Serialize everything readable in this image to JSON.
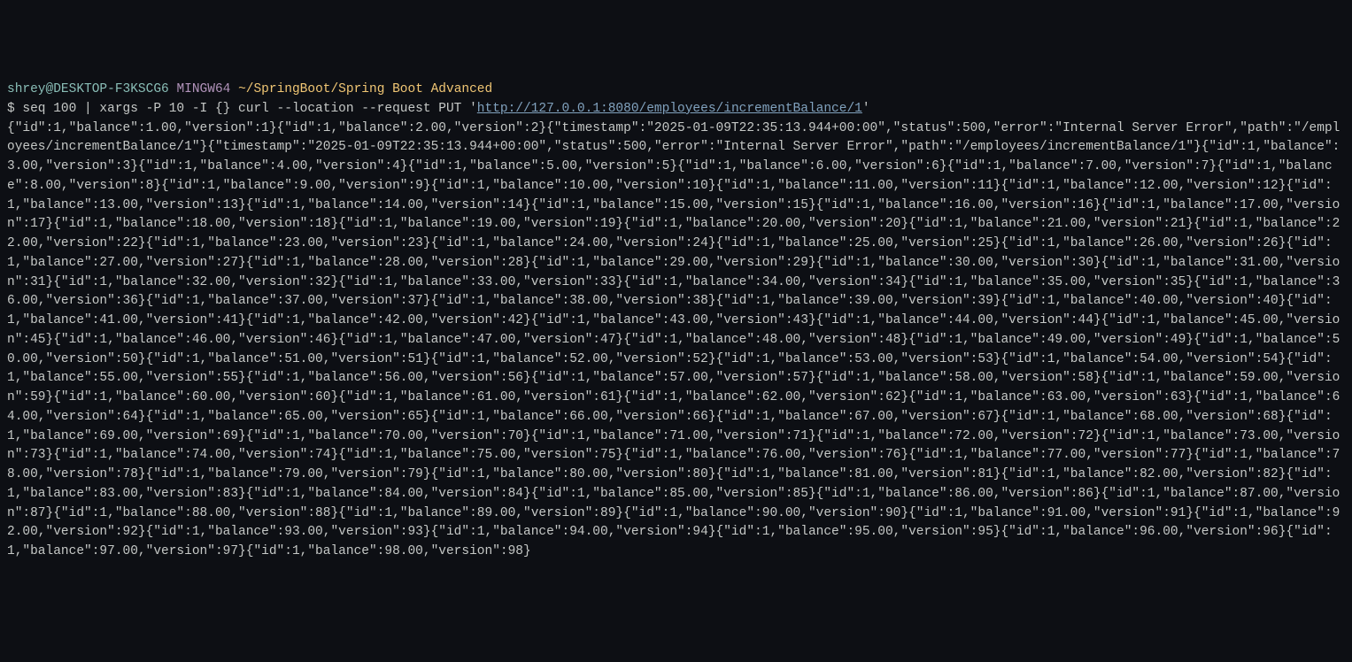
{
  "prompt": {
    "user_host": "shrey@DESKTOP-F3KSCG6",
    "mingw": "MINGW64",
    "path": "~/SpringBoot/Spring Boot Advanced",
    "dollar": "$",
    "command_pre": "seq 100 | xargs -P 10 -I {} curl --location --request PUT '",
    "url": "http://127.0.0.1:8080/employees/incrementBalance/1",
    "command_post": "'"
  },
  "output": "{\"id\":1,\"balance\":1.00,\"version\":1}{\"id\":1,\"balance\":2.00,\"version\":2}{\"timestamp\":\"2025-01-09T22:35:13.944+00:00\",\"status\":500,\"error\":\"Internal Server Error\",\"path\":\"/employees/incrementBalance/1\"}{\"timestamp\":\"2025-01-09T22:35:13.944+00:00\",\"status\":500,\"error\":\"Internal Server Error\",\"path\":\"/employees/incrementBalance/1\"}{\"id\":1,\"balance\":3.00,\"version\":3}{\"id\":1,\"balance\":4.00,\"version\":4}{\"id\":1,\"balance\":5.00,\"version\":5}{\"id\":1,\"balance\":6.00,\"version\":6}{\"id\":1,\"balance\":7.00,\"version\":7}{\"id\":1,\"balance\":8.00,\"version\":8}{\"id\":1,\"balance\":9.00,\"version\":9}{\"id\":1,\"balance\":10.00,\"version\":10}{\"id\":1,\"balance\":11.00,\"version\":11}{\"id\":1,\"balance\":12.00,\"version\":12}{\"id\":1,\"balance\":13.00,\"version\":13}{\"id\":1,\"balance\":14.00,\"version\":14}{\"id\":1,\"balance\":15.00,\"version\":15}{\"id\":1,\"balance\":16.00,\"version\":16}{\"id\":1,\"balance\":17.00,\"version\":17}{\"id\":1,\"balance\":18.00,\"version\":18}{\"id\":1,\"balance\":19.00,\"version\":19}{\"id\":1,\"balance\":20.00,\"version\":20}{\"id\":1,\"balance\":21.00,\"version\":21}{\"id\":1,\"balance\":22.00,\"version\":22}{\"id\":1,\"balance\":23.00,\"version\":23}{\"id\":1,\"balance\":24.00,\"version\":24}{\"id\":1,\"balance\":25.00,\"version\":25}{\"id\":1,\"balance\":26.00,\"version\":26}{\"id\":1,\"balance\":27.00,\"version\":27}{\"id\":1,\"balance\":28.00,\"version\":28}{\"id\":1,\"balance\":29.00,\"version\":29}{\"id\":1,\"balance\":30.00,\"version\":30}{\"id\":1,\"balance\":31.00,\"version\":31}{\"id\":1,\"balance\":32.00,\"version\":32}{\"id\":1,\"balance\":33.00,\"version\":33}{\"id\":1,\"balance\":34.00,\"version\":34}{\"id\":1,\"balance\":35.00,\"version\":35}{\"id\":1,\"balance\":36.00,\"version\":36}{\"id\":1,\"balance\":37.00,\"version\":37}{\"id\":1,\"balance\":38.00,\"version\":38}{\"id\":1,\"balance\":39.00,\"version\":39}{\"id\":1,\"balance\":40.00,\"version\":40}{\"id\":1,\"balance\":41.00,\"version\":41}{\"id\":1,\"balance\":42.00,\"version\":42}{\"id\":1,\"balance\":43.00,\"version\":43}{\"id\":1,\"balance\":44.00,\"version\":44}{\"id\":1,\"balance\":45.00,\"version\":45}{\"id\":1,\"balance\":46.00,\"version\":46}{\"id\":1,\"balance\":47.00,\"version\":47}{\"id\":1,\"balance\":48.00,\"version\":48}{\"id\":1,\"balance\":49.00,\"version\":49}{\"id\":1,\"balance\":50.00,\"version\":50}{\"id\":1,\"balance\":51.00,\"version\":51}{\"id\":1,\"balance\":52.00,\"version\":52}{\"id\":1,\"balance\":53.00,\"version\":53}{\"id\":1,\"balance\":54.00,\"version\":54}{\"id\":1,\"balance\":55.00,\"version\":55}{\"id\":1,\"balance\":56.00,\"version\":56}{\"id\":1,\"balance\":57.00,\"version\":57}{\"id\":1,\"balance\":58.00,\"version\":58}{\"id\":1,\"balance\":59.00,\"version\":59}{\"id\":1,\"balance\":60.00,\"version\":60}{\"id\":1,\"balance\":61.00,\"version\":61}{\"id\":1,\"balance\":62.00,\"version\":62}{\"id\":1,\"balance\":63.00,\"version\":63}{\"id\":1,\"balance\":64.00,\"version\":64}{\"id\":1,\"balance\":65.00,\"version\":65}{\"id\":1,\"balance\":66.00,\"version\":66}{\"id\":1,\"balance\":67.00,\"version\":67}{\"id\":1,\"balance\":68.00,\"version\":68}{\"id\":1,\"balance\":69.00,\"version\":69}{\"id\":1,\"balance\":70.00,\"version\":70}{\"id\":1,\"balance\":71.00,\"version\":71}{\"id\":1,\"balance\":72.00,\"version\":72}{\"id\":1,\"balance\":73.00,\"version\":73}{\"id\":1,\"balance\":74.00,\"version\":74}{\"id\":1,\"balance\":75.00,\"version\":75}{\"id\":1,\"balance\":76.00,\"version\":76}{\"id\":1,\"balance\":77.00,\"version\":77}{\"id\":1,\"balance\":78.00,\"version\":78}{\"id\":1,\"balance\":79.00,\"version\":79}{\"id\":1,\"balance\":80.00,\"version\":80}{\"id\":1,\"balance\":81.00,\"version\":81}{\"id\":1,\"balance\":82.00,\"version\":82}{\"id\":1,\"balance\":83.00,\"version\":83}{\"id\":1,\"balance\":84.00,\"version\":84}{\"id\":1,\"balance\":85.00,\"version\":85}{\"id\":1,\"balance\":86.00,\"version\":86}{\"id\":1,\"balance\":87.00,\"version\":87}{\"id\":1,\"balance\":88.00,\"version\":88}{\"id\":1,\"balance\":89.00,\"version\":89}{\"id\":1,\"balance\":90.00,\"version\":90}{\"id\":1,\"balance\":91.00,\"version\":91}{\"id\":1,\"balance\":92.00,\"version\":92}{\"id\":1,\"balance\":93.00,\"version\":93}{\"id\":1,\"balance\":94.00,\"version\":94}{\"id\":1,\"balance\":95.00,\"version\":95}{\"id\":1,\"balance\":96.00,\"version\":96}{\"id\":1,\"balance\":97.00,\"version\":97}{\"id\":1,\"balance\":98.00,\"version\":98}"
}
